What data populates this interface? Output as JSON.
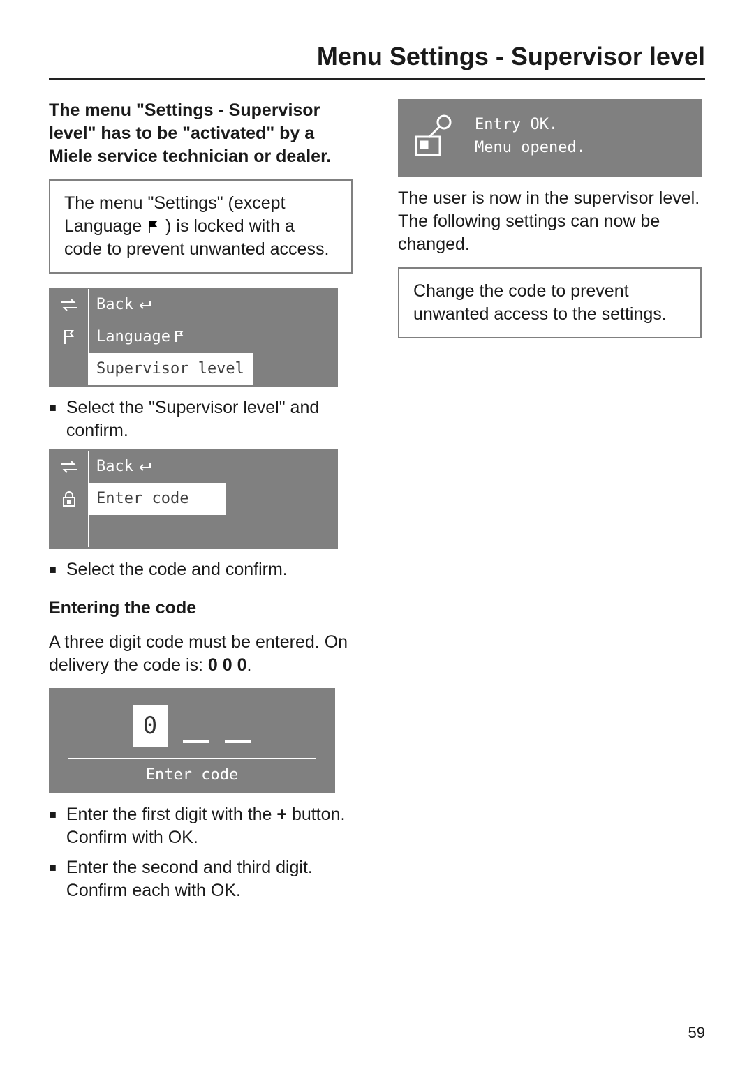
{
  "page_title": "Menu Settings - Supervisor level",
  "page_number": "59",
  "left": {
    "intro_bold": "The menu \"Settings - Supervisor level\" has to be \"activated\" by a Miele service technician or dealer.",
    "note1_a": "The menu \"Settings\" (except Language ",
    "note1_b": ") is locked with a code to prevent unwanted access.",
    "lcd1": {
      "row1_icon": "arrows-icon",
      "row1_label": "Back",
      "row2_icon": "flag-icon",
      "row2_label": "Language",
      "row3_label": "Supervisor level"
    },
    "step1": "Select the \"Supervisor level\" and confirm.",
    "lcd2": {
      "row1_icon": "arrows-icon",
      "row1_label": "Back",
      "row2_icon": "lock-icon",
      "row2_label": "Enter code"
    },
    "step2": "Select the code and confirm.",
    "heading": "Entering the code",
    "code_intro_a": "A three digit code must be entered. On delivery the code is: ",
    "code_value": "0 0 0",
    "code_intro_b": ".",
    "lcd3": {
      "digit": "0",
      "caption": "Enter code"
    },
    "step3_a": "Enter the first digit with the ",
    "step3_plus": "+",
    "step3_b": " button. Confirm with OK.",
    "step4": "Enter the second and third digit. Confirm each with OK."
  },
  "right": {
    "lcd_entry": {
      "line1": "Entry OK.",
      "line2": "Menu opened."
    },
    "after": "The user is now in the supervisor level. The following settings can now be changed.",
    "note": "Change the code to prevent unwanted access to the settings."
  }
}
